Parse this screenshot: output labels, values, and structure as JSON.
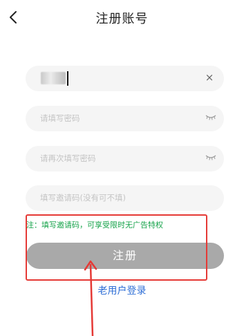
{
  "header": {
    "title": "注册账号",
    "back_icon": "chevron-left-icon"
  },
  "form": {
    "account": {
      "value_redacted": true,
      "clear_icon": "close-icon",
      "clear_glyph": "×"
    },
    "password": {
      "placeholder": "请填写密码",
      "toggle_icon": "eye-closed-icon"
    },
    "confirm_password": {
      "placeholder": "请再次填写密码",
      "toggle_icon": "eye-closed-icon"
    },
    "invite_code": {
      "placeholder": "填写邀请码(没有可不填)"
    },
    "note": "注：填写邀请码，可享受限时无广告特权"
  },
  "actions": {
    "register_label": "注册",
    "login_link": "老用户登录"
  },
  "colors": {
    "button_bg": "#a9a9a9",
    "note": "#16a34a",
    "link": "#2f6fd6",
    "annotation": "#e53935",
    "field_bg": "#f5f5f5"
  }
}
